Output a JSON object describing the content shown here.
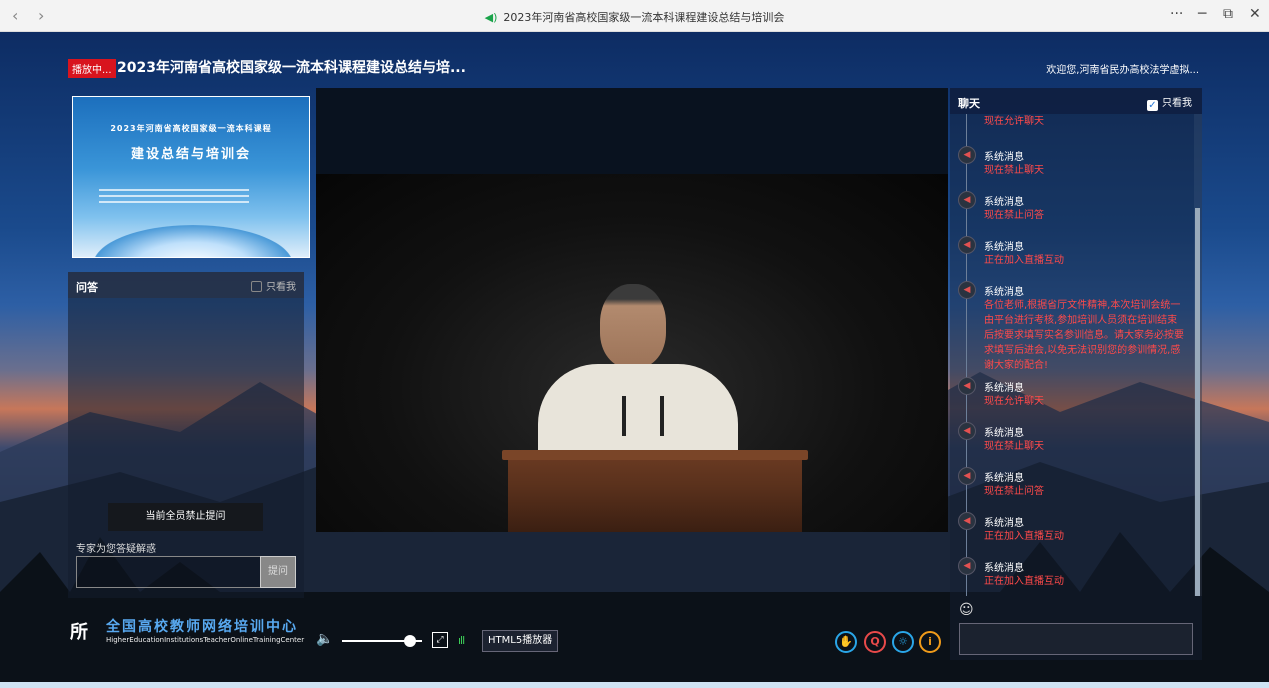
{
  "window": {
    "back": "‹",
    "forward": "›",
    "title": "2023年河南省高校国家级一流本科课程建设总结与培训会",
    "more": "···",
    "minimize": "─",
    "restore": "⧉",
    "close": "✕"
  },
  "header": {
    "live_badge": "播放中...",
    "title": "2023年河南省高校国家级一流本科课程建设总结与培...",
    "welcome": "欢迎您,河南省民办高校法学虚拟..."
  },
  "thumbnail": {
    "line1": "2023年河南省高校国家级一流本科课程",
    "line2": "建设总结与培训会"
  },
  "qa": {
    "title": "问答",
    "only_me": "只看我",
    "ban_notice": "当前全员禁止提问",
    "hint": "专家为您答疑解惑",
    "input_placeholder": "",
    "submit": "提问"
  },
  "player": {
    "volume_icon": "speaker-icon",
    "volume": 0.85,
    "fullscreen": "⤢",
    "signal": "ıll",
    "html5": "HTML5播放器"
  },
  "tools": [
    {
      "icon": "hand-icon",
      "glyph": "✋",
      "color": "#2aa6e8"
    },
    {
      "icon": "question-user-icon",
      "glyph": "Q",
      "color": "#e84a4a"
    },
    {
      "icon": "settings-sun-icon",
      "glyph": "☼",
      "color": "#2aa6e8"
    },
    {
      "icon": "info-icon",
      "glyph": "i",
      "color": "#f09b1a"
    }
  ],
  "logo": {
    "mark": "所",
    "cn": "全国高校教师网络培训中心",
    "en": "HigherEducationInstitutionsTeacherOnlineTrainingCenter"
  },
  "chat": {
    "title": "聊天",
    "only_me": "只看我",
    "messages": [
      {
        "who": "",
        "text": "现在允许聊天"
      },
      {
        "who": "系统消息",
        "text": "现在禁止聊天"
      },
      {
        "who": "系统消息",
        "text": "现在禁止问答"
      },
      {
        "who": "系统消息",
        "text": "正在加入直播互动"
      },
      {
        "who": "系统消息",
        "text": "各位老师,根据省厅文件精神,本次培训会统一由平台进行考核,参加培训人员须在培训结束后按要求填写实名参训信息。请大家务必按要求填写后进会,以免无法识别您的参训情况,感谢大家的配合!"
      },
      {
        "who": "系统消息",
        "text": "现在允许聊天"
      },
      {
        "who": "系统消息",
        "text": "现在禁止聊天"
      },
      {
        "who": "系统消息",
        "text": "现在禁止问答"
      },
      {
        "who": "系统消息",
        "text": "正在加入直播互动"
      },
      {
        "who": "系统消息",
        "text": "正在加入直播互动"
      }
    ],
    "emoji": "☺",
    "input_placeholder": ""
  },
  "colors": {
    "accent_red": "#d8141e",
    "system_text": "#ff4a4a",
    "signal_green": "#3fd35a"
  }
}
